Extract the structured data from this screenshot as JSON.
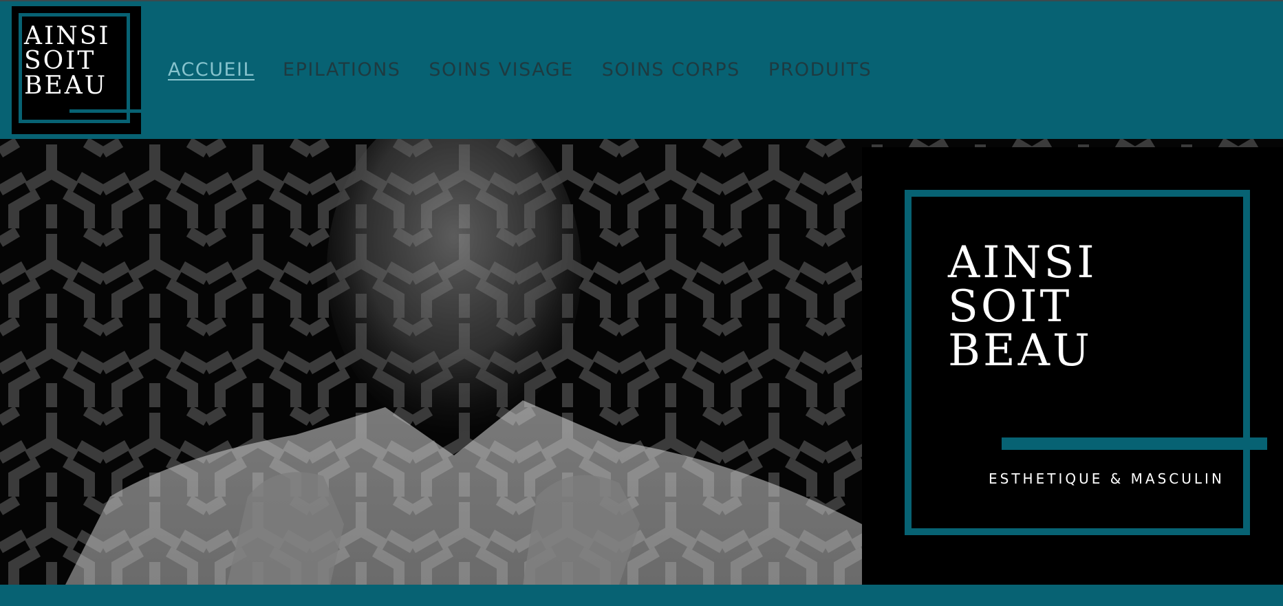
{
  "header": {
    "logo_lines": [
      "AINSI",
      "SOIT",
      "BEAU"
    ],
    "nav": [
      {
        "label": "ACCUEIL",
        "active": true
      },
      {
        "label": "EPILATIONS",
        "active": false
      },
      {
        "label": "SOINS VISAGE",
        "active": false
      },
      {
        "label": "SOINS CORPS",
        "active": false
      },
      {
        "label": "PRODUITS",
        "active": false
      }
    ]
  },
  "hero": {
    "image": "man-portrait-with-geometric-pattern-overlay",
    "brand_lines": [
      "AINSI",
      "SOIT",
      "BEAU"
    ],
    "tagline": "ESTHETIQUE & MASCULIN"
  },
  "colors": {
    "brand_teal": "#076273",
    "nav_text": "#1e3a40",
    "nav_active": "#86c3cd",
    "panel_black": "#000000"
  }
}
